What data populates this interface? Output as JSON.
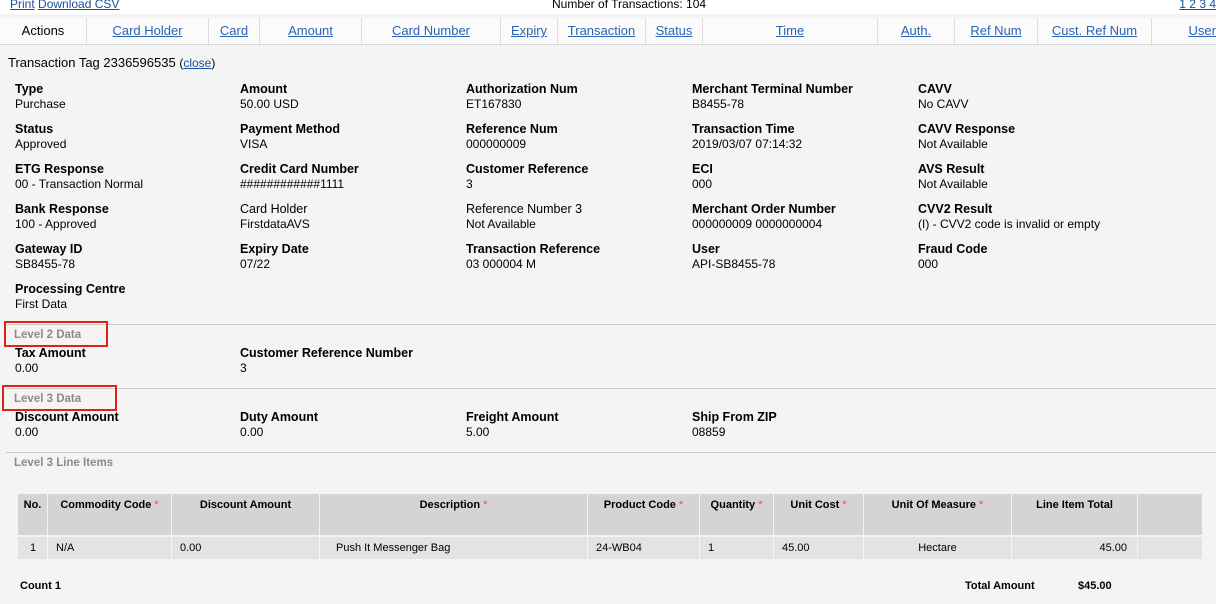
{
  "top": {
    "print": "Print",
    "download_csv": "Download CSV",
    "transaction_count": "Number of Transactions: 104",
    "pages": "1 2 3 4"
  },
  "columns": {
    "actions": "Actions",
    "card_holder": "Card Holder",
    "card": "Card",
    "amount": "Amount",
    "card_number": "Card Number",
    "expiry": "Expiry",
    "transaction": "Transaction",
    "status": "Status",
    "time": "Time",
    "auth": "Auth.",
    "ref_num": "Ref Num",
    "cust_ref_num": "Cust. Ref Num",
    "user": "User"
  },
  "detail": {
    "title": "Transaction Tag 2336596535",
    "close_label": "close",
    "fields": [
      {
        "label": "Type",
        "value": "Purchase"
      },
      {
        "label": "Amount",
        "value": "50.00 USD"
      },
      {
        "label": "Authorization Num",
        "value": "ET167830"
      },
      {
        "label": "Merchant Terminal Number",
        "value": "B8455-78"
      },
      {
        "label": "CAVV",
        "value": "No CAVV"
      },
      {
        "label": "Status",
        "value": "Approved"
      },
      {
        "label": "Payment Method",
        "value": "VISA"
      },
      {
        "label": "Reference Num",
        "value": "000000009"
      },
      {
        "label": "Transaction Time",
        "value": "2019/03/07 07:14:32"
      },
      {
        "label": "CAVV Response",
        "value": "Not Available"
      },
      {
        "label": "ETG Response",
        "value": "00 - Transaction Normal"
      },
      {
        "label": "Credit Card Number",
        "value": "############1111"
      },
      {
        "label": "Customer Reference",
        "value": "3"
      },
      {
        "label": "ECI",
        "value": "000"
      },
      {
        "label": "AVS Result",
        "value": "Not Available"
      },
      {
        "label": "Bank Response",
        "value": "100 - Approved"
      },
      {
        "label": "Card Holder",
        "value": "FirstdataAVS"
      },
      {
        "label": "Reference Number 3",
        "value": "Not Available"
      },
      {
        "label": "Merchant Order Number",
        "value": "000000009 0000000004"
      },
      {
        "label": "CVV2 Result",
        "value": "(I) - CVV2 code is invalid or empty"
      },
      {
        "label": "Gateway ID",
        "value": "SB8455-78"
      },
      {
        "label": "Expiry Date",
        "value": "07/22"
      },
      {
        "label": "Transaction Reference",
        "value": "03 000004 M"
      },
      {
        "label": "User",
        "value": "API-SB8455-78"
      },
      {
        "label": "Fraud Code",
        "value": "000"
      },
      {
        "label": "Processing Centre",
        "value": "First Data"
      }
    ]
  },
  "level2": {
    "title": "Level 2 Data",
    "fields": [
      {
        "label": "Tax Amount",
        "value": "0.00"
      },
      {
        "label": "Customer Reference Number",
        "value": "3"
      }
    ]
  },
  "level3": {
    "title": "Level 3 Data",
    "fields": [
      {
        "label": "Discount Amount",
        "value": "0.00"
      },
      {
        "label": "Duty Amount",
        "value": "0.00"
      },
      {
        "label": "Freight Amount",
        "value": "5.00"
      },
      {
        "label": "Ship From ZIP",
        "value": "08859"
      }
    ]
  },
  "line_items": {
    "title": "Level 3 Line Items",
    "required_mark": "*",
    "headers": [
      "No.",
      "Commodity Code",
      "Discount Amount",
      "Description",
      "Product Code",
      "Quantity",
      "Unit Cost",
      "Unit Of Measure",
      "Line Item Total"
    ],
    "rows": [
      [
        "1",
        "N/A",
        "0.00",
        "Push It Messenger Bag",
        "24-WB04",
        "1",
        "45.00",
        "Hectare",
        "45.00"
      ]
    ],
    "count_label": "Count 1",
    "total_label": "Total Amount",
    "total_value": "$45.00"
  },
  "colors": {
    "highlight_box": "#e0201b",
    "link": "#2a63b4",
    "section_title": "#8a8a8a"
  }
}
